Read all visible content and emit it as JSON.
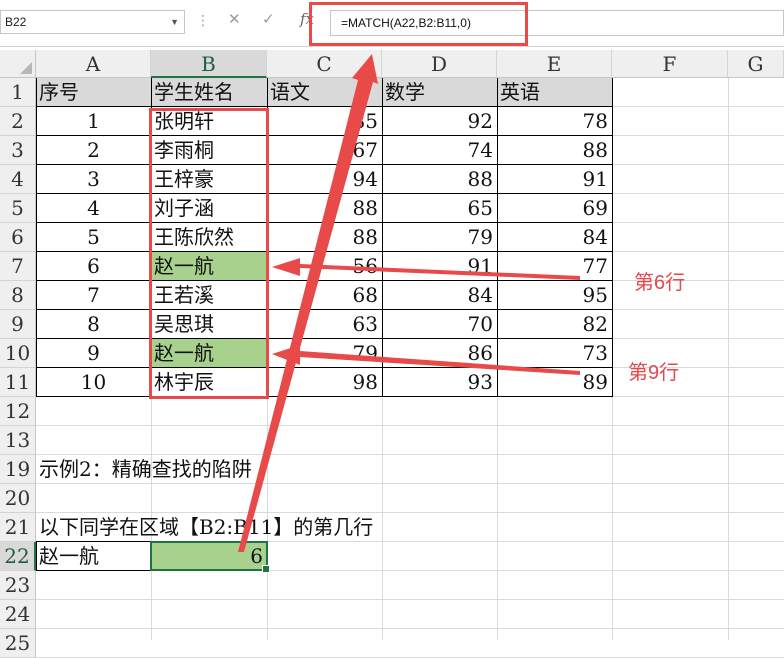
{
  "formula_bar": {
    "name_box": "B22",
    "cancel_icon": "✕",
    "enter_icon": "✓",
    "fx_label": "fx",
    "formula": "=MATCH(A22,B2:B11,0)"
  },
  "columns": [
    "A",
    "B",
    "C",
    "D",
    "E",
    "F",
    "G"
  ],
  "rows": [
    "1",
    "2",
    "3",
    "4",
    "5",
    "6",
    "7",
    "8",
    "9",
    "10",
    "11",
    "12",
    "13",
    "19",
    "20",
    "21",
    "22",
    "23",
    "24",
    "25"
  ],
  "table": {
    "headers": [
      "序号",
      "学生姓名",
      "语文",
      "数学",
      "英语"
    ],
    "records": [
      {
        "no": "1",
        "name": "张明轩",
        "chinese": "85",
        "math": "92",
        "english": "78"
      },
      {
        "no": "2",
        "name": "李雨桐",
        "chinese": "67",
        "math": "74",
        "english": "88"
      },
      {
        "no": "3",
        "name": "王梓豪",
        "chinese": "94",
        "math": "88",
        "english": "91"
      },
      {
        "no": "4",
        "name": "刘子涵",
        "chinese": "88",
        "math": "65",
        "english": "69"
      },
      {
        "no": "5",
        "name": "王陈欣然",
        "chinese": "88",
        "math": "79",
        "english": "84"
      },
      {
        "no": "6",
        "name": "赵一航",
        "chinese": "56",
        "math": "91",
        "english": "77"
      },
      {
        "no": "7",
        "name": "王若溪",
        "chinese": "68",
        "math": "84",
        "english": "95"
      },
      {
        "no": "8",
        "name": "吴思琪",
        "chinese": "63",
        "math": "70",
        "english": "82"
      },
      {
        "no": "9",
        "name": "赵一航",
        "chinese": "79",
        "math": "86",
        "english": "73"
      },
      {
        "no": "10",
        "name": "林宇辰",
        "chinese": "98",
        "math": "93",
        "english": "89"
      }
    ]
  },
  "example_title": "示例2：精确查找的陷阱",
  "question": "以下同学在区域【B2:B11】的第几行",
  "lookup": {
    "name": "赵一航",
    "result": "6"
  },
  "annotations": {
    "row6": "第6行",
    "row9": "第9行"
  },
  "colors": {
    "accent_red": "#e84a4a",
    "match_green": "#a9d18e",
    "excel_green": "#217346"
  }
}
